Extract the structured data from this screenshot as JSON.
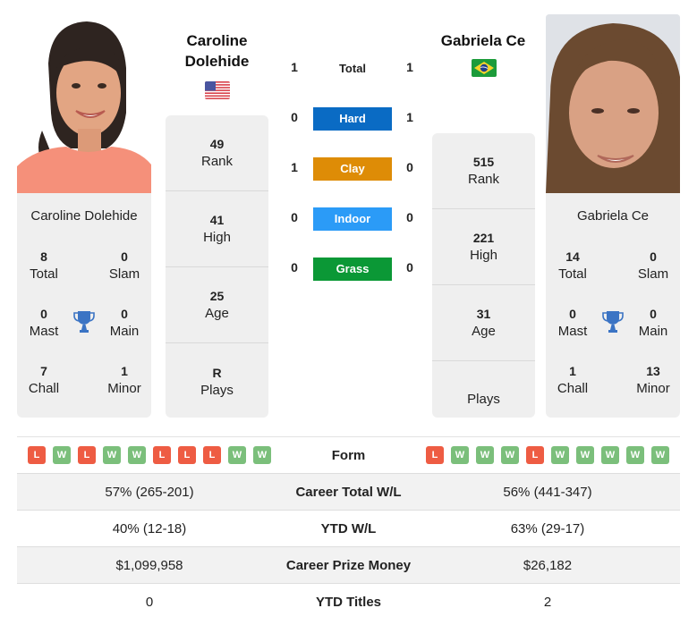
{
  "h2h": {
    "total": {
      "label": "Total",
      "left": "1",
      "right": "1"
    },
    "surfaces": [
      {
        "label": "Hard",
        "left": "0",
        "right": "1",
        "color": "#0a6bc4"
      },
      {
        "label": "Clay",
        "left": "1",
        "right": "0",
        "color": "#de8c06"
      },
      {
        "label": "Indoor",
        "left": "0",
        "right": "0",
        "color": "#2b9bf7"
      },
      {
        "label": "Grass",
        "left": "0",
        "right": "0",
        "color": "#0b9836"
      }
    ]
  },
  "players": {
    "left": {
      "name": "Caroline Dolehide",
      "name_line1": "Caroline",
      "name_line2": "Dolehide",
      "flag": "us-flag",
      "stats": [
        {
          "value": "49",
          "label": "Rank"
        },
        {
          "value": "41",
          "label": "High"
        },
        {
          "value": "25",
          "label": "Age"
        },
        {
          "value": "R",
          "label": "Plays"
        }
      ],
      "titles": {
        "total": {
          "value": "8",
          "label": "Total"
        },
        "slam": {
          "value": "0",
          "label": "Slam"
        },
        "mast": {
          "value": "0",
          "label": "Mast"
        },
        "main": {
          "value": "0",
          "label": "Main"
        },
        "chall": {
          "value": "7",
          "label": "Chall"
        },
        "minor": {
          "value": "1",
          "label": "Minor"
        }
      }
    },
    "right": {
      "name": "Gabriela Ce",
      "flag": "brazil-flag",
      "stats": [
        {
          "value": "515",
          "label": "Rank"
        },
        {
          "value": "221",
          "label": "High"
        },
        {
          "value": "31",
          "label": "Age"
        },
        {
          "value": "",
          "label": "Plays"
        }
      ],
      "titles": {
        "total": {
          "value": "14",
          "label": "Total"
        },
        "slam": {
          "value": "0",
          "label": "Slam"
        },
        "mast": {
          "value": "0",
          "label": "Mast"
        },
        "main": {
          "value": "0",
          "label": "Main"
        },
        "chall": {
          "value": "1",
          "label": "Chall"
        },
        "minor": {
          "value": "13",
          "label": "Minor"
        }
      }
    }
  },
  "comparison": {
    "form": {
      "label": "Form",
      "left": [
        "L",
        "W",
        "L",
        "W",
        "W",
        "L",
        "L",
        "L",
        "W",
        "W"
      ],
      "right": [
        "L",
        "W",
        "W",
        "W",
        "L",
        "W",
        "W",
        "W",
        "W",
        "W"
      ]
    },
    "rows": [
      {
        "label": "Career Total W/L",
        "left": "57% (265-201)",
        "right": "56% (441-347)"
      },
      {
        "label": "YTD W/L",
        "left": "40% (12-18)",
        "right": "63% (29-17)"
      },
      {
        "label": "Career Prize Money",
        "left": "$1,099,958",
        "right": "$26,182"
      },
      {
        "label": "YTD Titles",
        "left": "0",
        "right": "2"
      }
    ]
  },
  "colors": {
    "loss": "#ee5c43",
    "win": "#7bbf7b",
    "trophy": "#3b74c4"
  }
}
